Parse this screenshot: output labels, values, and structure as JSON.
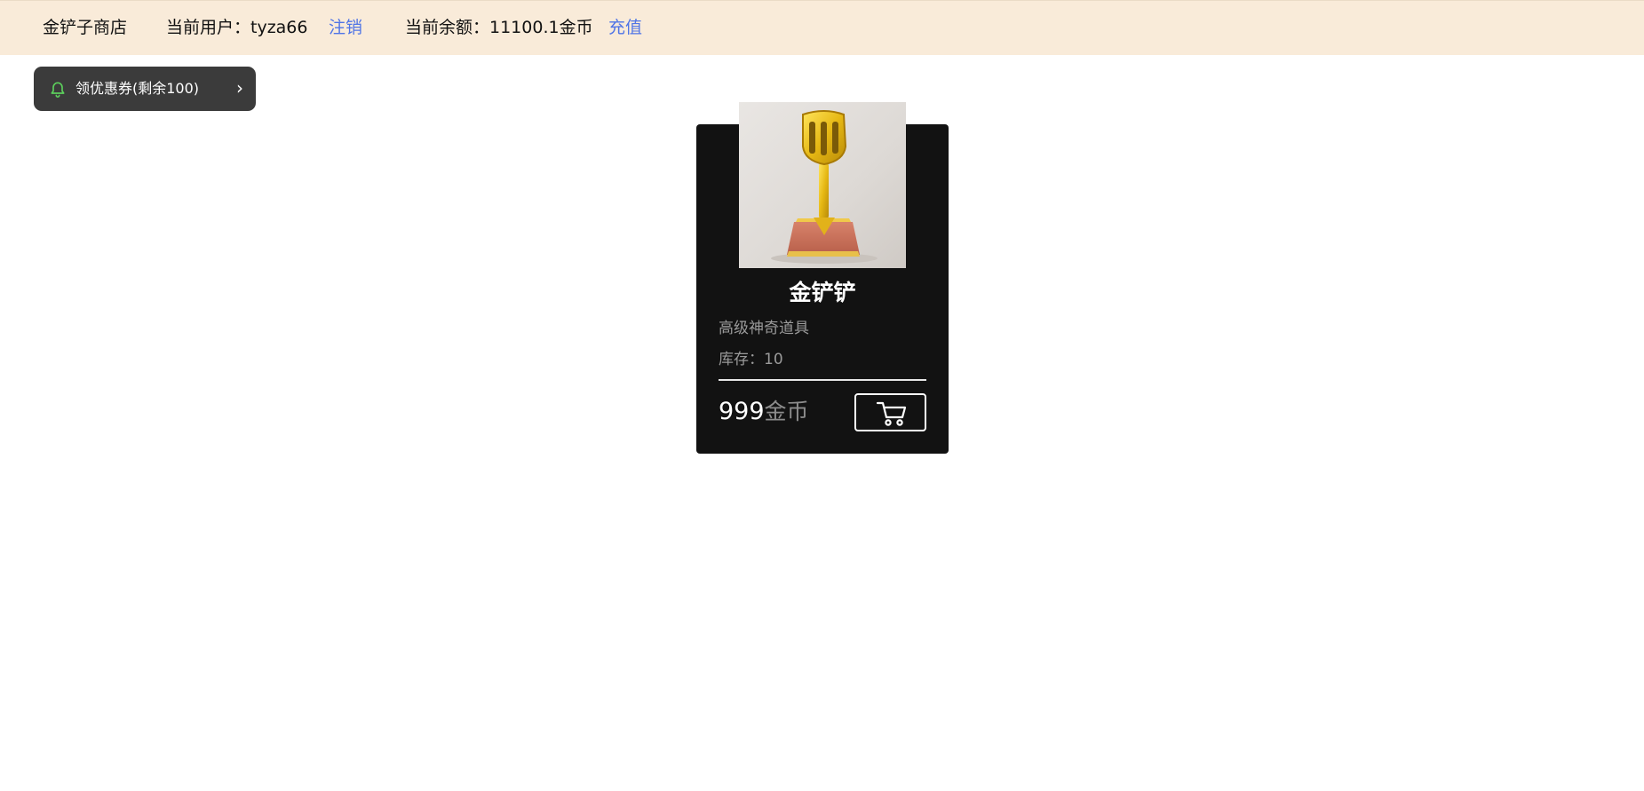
{
  "header": {
    "brand": "金铲子商店",
    "user_label": "当前用户：tyza66",
    "logout_label": "注销",
    "balance_label": "当前余额：11100.1金币",
    "recharge_label": "充值"
  },
  "coupon": {
    "icon": "bell-icon",
    "label": "领优惠券(剩余100)",
    "chevron": "›"
  },
  "product": {
    "name": "金铲铲",
    "description": "高级神奇道具",
    "stock_label": "库存：10",
    "price": "999",
    "price_unit": "金币",
    "cart_icon": "cart-icon"
  },
  "colors": {
    "header_bg": "#f9ebd9",
    "link": "#4f74e6",
    "card_bg": "#121212",
    "coupon_bg": "#3b3b3b",
    "bell": "#5ccf5c"
  }
}
